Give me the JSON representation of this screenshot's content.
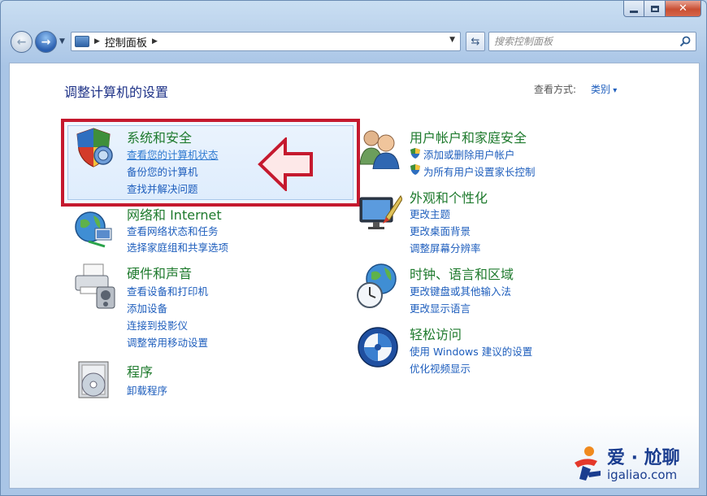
{
  "window": {
    "caption_buttons": [
      "minimize",
      "maximize",
      "close"
    ]
  },
  "nav": {
    "breadcrumb": "控制面板",
    "search_placeholder": "搜索控制面板"
  },
  "header": {
    "title": "调整计算机的设置",
    "view_by_label": "查看方式:",
    "view_by_value": "类别"
  },
  "categories": [
    {
      "title": "系统和安全",
      "links": [
        "查看您的计算机状态",
        "备份您的计算机",
        "查找并解决问题"
      ]
    },
    {
      "title": "网络和 Internet",
      "links": [
        "查看网络状态和任务",
        "选择家庭组和共享选项"
      ]
    },
    {
      "title": "硬件和声音",
      "links": [
        "查看设备和打印机",
        "添加设备",
        "连接到投影仪",
        "调整常用移动设置"
      ]
    },
    {
      "title": "程序",
      "links": [
        "卸载程序"
      ]
    },
    {
      "title": "用户帐户和家庭安全",
      "links": [
        "添加或删除用户帐户",
        "为所有用户设置家长控制"
      ]
    },
    {
      "title": "外观和个性化",
      "links": [
        "更改主题",
        "更改桌面背景",
        "调整屏幕分辨率"
      ]
    },
    {
      "title": "时钟、语言和区域",
      "links": [
        "更改键盘或其他输入法",
        "更改显示语言"
      ]
    },
    {
      "title": "轻松访问",
      "links": [
        "使用 Windows 建议的设置",
        "优化视频显示"
      ]
    }
  ],
  "watermark": {
    "cn": "爱 · 尬聊",
    "en": "igaliao.com"
  },
  "colors": {
    "highlight_border": "#c5192e",
    "category_title": "#1e7a2d",
    "link": "#1e5ebd"
  }
}
